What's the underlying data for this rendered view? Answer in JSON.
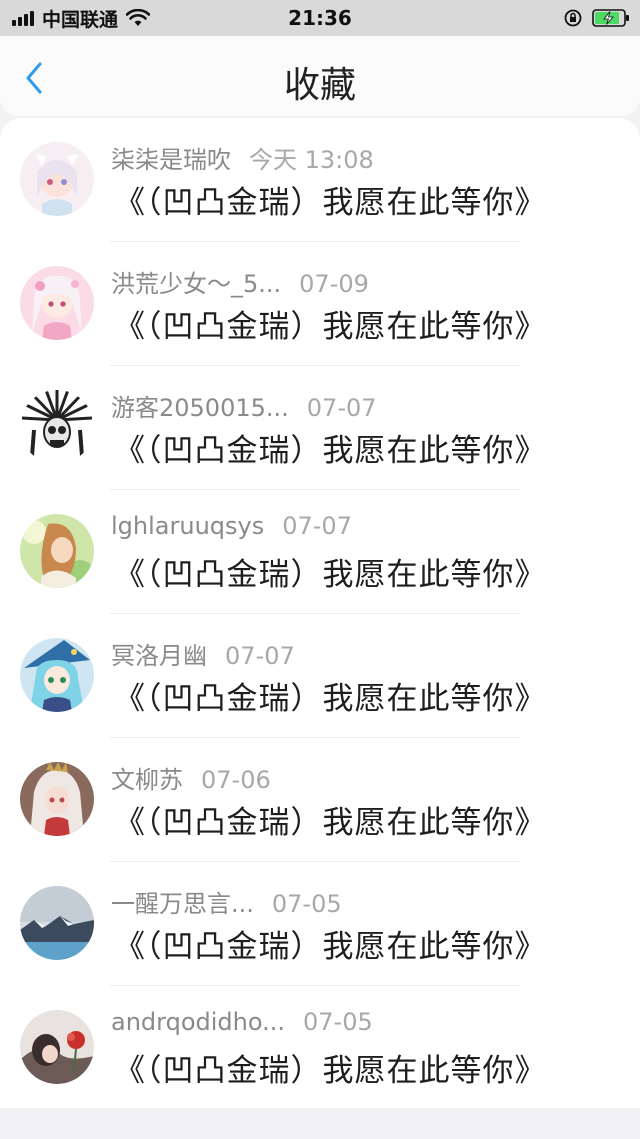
{
  "status_bar": {
    "carrier": "中国联通",
    "time": "21:36"
  },
  "nav": {
    "title": "收藏"
  },
  "favorites": [
    {
      "user": "柒柒是瑞吹",
      "time": "今天 13:08",
      "text": "《（凹凸金瑞）我愿在此等你》",
      "avatar": "anime-girl-pastel"
    },
    {
      "user": "洪荒少女～_5...",
      "time": "07-09",
      "text": "《（凹凸金瑞）我愿在此等你》",
      "avatar": "anime-girl-pink"
    },
    {
      "user": "游客2050015...",
      "time": "07-07",
      "text": "《（凹凸金瑞）我愿在此等你》",
      "avatar": "skull-headdress"
    },
    {
      "user": "lghlaruuqsys",
      "time": "07-07",
      "text": "《（凹凸金瑞）我愿在此等你》",
      "avatar": "girl-outdoor"
    },
    {
      "user": "冥洛月幽",
      "time": "07-07",
      "text": "《（凹凸金瑞）我愿在此等你》",
      "avatar": "anime-witch-blue"
    },
    {
      "user": "文柳苏",
      "time": "07-06",
      "text": "《（凹凸金瑞）我愿在此等你》",
      "avatar": "anime-girl-white-hair"
    },
    {
      "user": "一醒万思言...",
      "time": "07-05",
      "text": "《（凹凸金瑞）我愿在此等你》",
      "avatar": "mountain-sky"
    },
    {
      "user": "andrqodidho...",
      "time": "07-05",
      "text": "《（凹凸金瑞）我愿在此等你》",
      "avatar": "girl-red-flower"
    }
  ]
}
